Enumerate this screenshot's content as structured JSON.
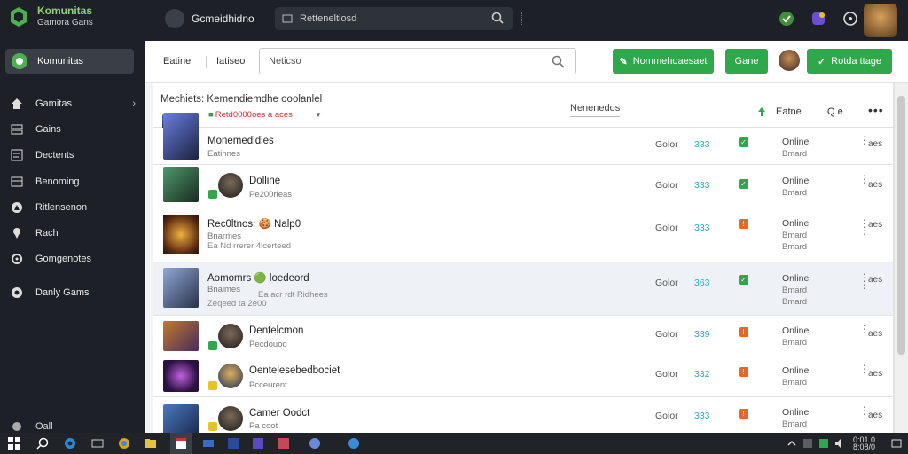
{
  "app": {
    "title": "Komunitas",
    "subtitle": "Gamora Gans"
  },
  "sidebar": {
    "active": {
      "label": "Komunitas",
      "icon": "community-icon"
    },
    "items": [
      {
        "label": "Gamitas",
        "icon": "home-icon",
        "has_chevron": true
      },
      {
        "label": "Gains",
        "icon": "layers-icon"
      },
      {
        "label": "Dectents",
        "icon": "document-icon"
      },
      {
        "label": "Benoming",
        "icon": "grid-icon"
      },
      {
        "label": "Ritlensenon",
        "icon": "compass-icon"
      },
      {
        "label": "Rach",
        "icon": "pin-icon"
      },
      {
        "label": "Gomgenotes",
        "icon": "settings-icon"
      },
      {
        "label": "Danly Gams",
        "icon": "help-icon"
      }
    ],
    "bottom": {
      "label": "Oall",
      "icon": "logout-icon"
    }
  },
  "topbar": {
    "title": "Gcmeidhidno",
    "search_value": "Retteneltiosd"
  },
  "toolbar": {
    "tab1": "Eatine",
    "tab2": "Iatiseo",
    "search_value": "Neticso",
    "btn_primary": "Nommehoaesaet",
    "btn_small": "Gane",
    "btn_secondary": "Rotda ttage"
  },
  "panel": {
    "title": "Mechiets: Kemendiemdhe ooolanlel",
    "subtitle": "Retd0000oes a aces",
    "filter": "Nenenedos",
    "status_label": "Eatne",
    "views": "Q e"
  },
  "rows": [
    {
      "title": "Monemedidles",
      "sub": "Eatinnes",
      "meta": "",
      "col1": "Golor",
      "col2": "333",
      "check": "green",
      "status": "Online",
      "status_sub": "Bmard",
      "more": "aes",
      "has_avatar": false
    },
    {
      "title": "Dolline",
      "sub": "Pe200rleas",
      "meta": "",
      "col1": "Golor",
      "col2": "333",
      "check": "green",
      "status": "Online",
      "status_sub": "Bmard",
      "more": "aes",
      "has_avatar": true
    },
    {
      "title": "Rec0ltnos: 🍪 Nalp0",
      "sub": "Bnarmes",
      "meta": "Ea Nd rrerer 4lcerteed",
      "col1": "Golor",
      "col2": "333",
      "check": "orange",
      "status": "Online",
      "status_sub": "Bmard",
      "status_sub2": "Bmard",
      "more": "aes",
      "has_avatar": false
    },
    {
      "title": "Aomomrs 🟢 loedeord",
      "sub": "Bnaimes",
      "meta": "Ea acr rdt Ridhees",
      "meta2": "Zeqeed ta 2e00",
      "col1": "Golor",
      "col2": "363",
      "check": "green",
      "status": "Online",
      "status_sub": "Bmard",
      "status_sub2": "Bmard",
      "more": "aes",
      "has_avatar": false
    },
    {
      "title": "Dentelcmon",
      "sub": "Pecdouod",
      "meta": "",
      "col1": "Golor",
      "col2": "339",
      "check": "orange",
      "status": "Online",
      "status_sub": "Bmard",
      "more": "aes",
      "has_avatar": true
    },
    {
      "title": "Oentelesebedbociet",
      "sub": "Pcceurent",
      "meta": "",
      "col1": "Golor",
      "col2": "332",
      "check": "orange",
      "status": "Online",
      "status_sub": "Bmard",
      "more": "aes",
      "has_avatar": true
    },
    {
      "title": "Camer Oodct",
      "sub": "Pa coot",
      "meta": "",
      "col1": "Golor",
      "col2": "333",
      "check": "orange",
      "status": "Online",
      "status_sub": "Bmard",
      "more": "aes",
      "has_avatar": true
    }
  ],
  "tray": {
    "time": "0:01.0",
    "date": "8:08/0"
  },
  "colors": {
    "accent": "#2ea84a",
    "sidebar": "#1d2026",
    "link": "#2aa8c4",
    "warn": "#e06a2a"
  }
}
